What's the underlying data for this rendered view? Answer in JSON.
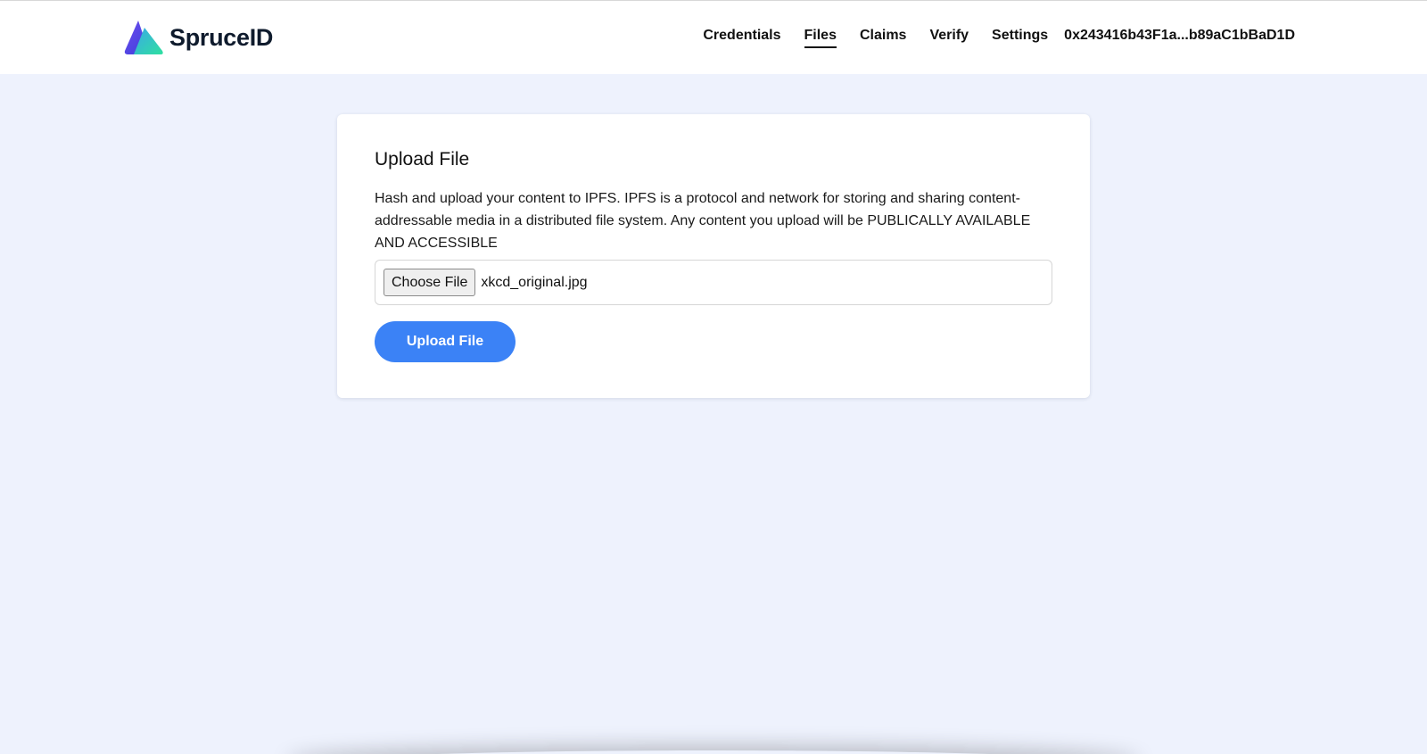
{
  "brand": {
    "name": "SpruceID",
    "logo_icon": "spruce-triangle-logo",
    "colors": {
      "purple": "#4f46e5",
      "green": "#2fd7a0",
      "text": "#0f1b2d"
    }
  },
  "nav": {
    "items": [
      {
        "label": "Credentials",
        "active": false
      },
      {
        "label": "Files",
        "active": true
      },
      {
        "label": "Claims",
        "active": false
      },
      {
        "label": "Verify",
        "active": false
      },
      {
        "label": "Settings",
        "active": false
      }
    ],
    "wallet_address": "0x243416b43F1a...b89aC1bBaD1D"
  },
  "card": {
    "title": "Upload File",
    "description": "Hash and upload your content to IPFS. IPFS is a protocol and network for storing and sharing content-addressable media in a distributed file system. Any content you upload will be PUBLICALLY AVAILABLE AND ACCESSIBLE",
    "file_input": {
      "button_label": "Choose File",
      "selected_file": "xkcd_original.jpg"
    },
    "upload_button_label": "Upload File",
    "accent_color": "#3b82f6"
  }
}
